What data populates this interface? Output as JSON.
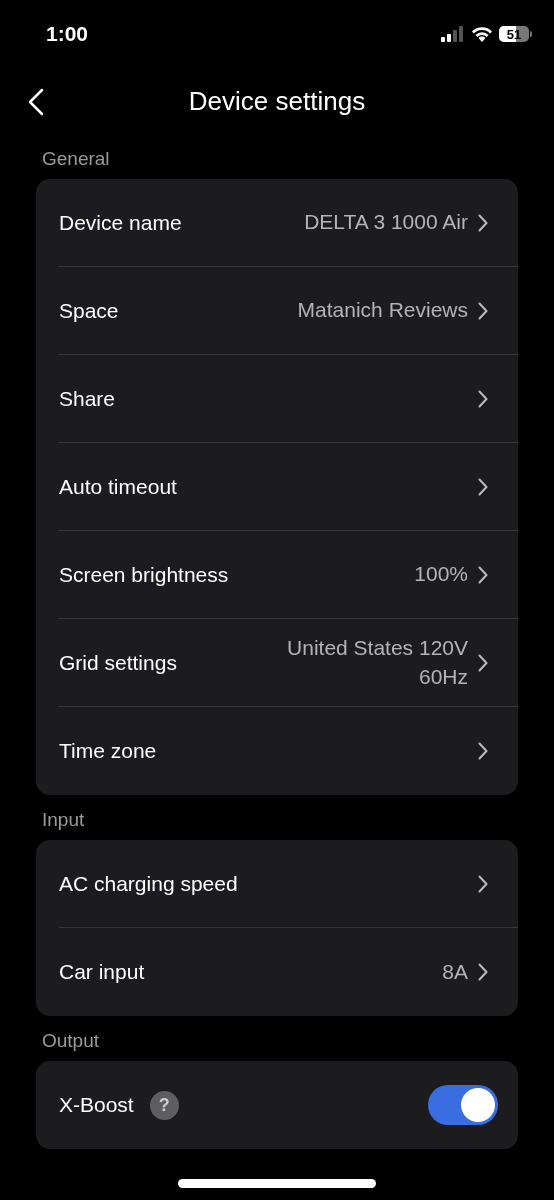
{
  "status_bar": {
    "time": "1:00",
    "battery": "51"
  },
  "header": {
    "title": "Device settings"
  },
  "sections": [
    {
      "title": "General",
      "rows": [
        {
          "kind": "nav",
          "label": "Device name",
          "value": "DELTA 3 1000 Air"
        },
        {
          "kind": "nav",
          "label": "Space",
          "value": "Matanich Reviews"
        },
        {
          "kind": "nav",
          "label": "Share"
        },
        {
          "kind": "nav",
          "label": "Auto timeout"
        },
        {
          "kind": "nav",
          "label": "Screen brightness",
          "value": "100%"
        },
        {
          "kind": "nav",
          "label": "Grid settings",
          "value": "United States 120V\n60Hz"
        },
        {
          "kind": "nav",
          "label": "Time zone"
        }
      ]
    },
    {
      "title": "Input",
      "rows": [
        {
          "kind": "nav",
          "label": "AC charging speed"
        },
        {
          "kind": "nav",
          "label": "Car input",
          "value": "8A"
        }
      ]
    },
    {
      "title": "Output",
      "rows": [
        {
          "kind": "toggle",
          "label": "X-Boost",
          "help": "?",
          "on": true
        }
      ]
    }
  ]
}
